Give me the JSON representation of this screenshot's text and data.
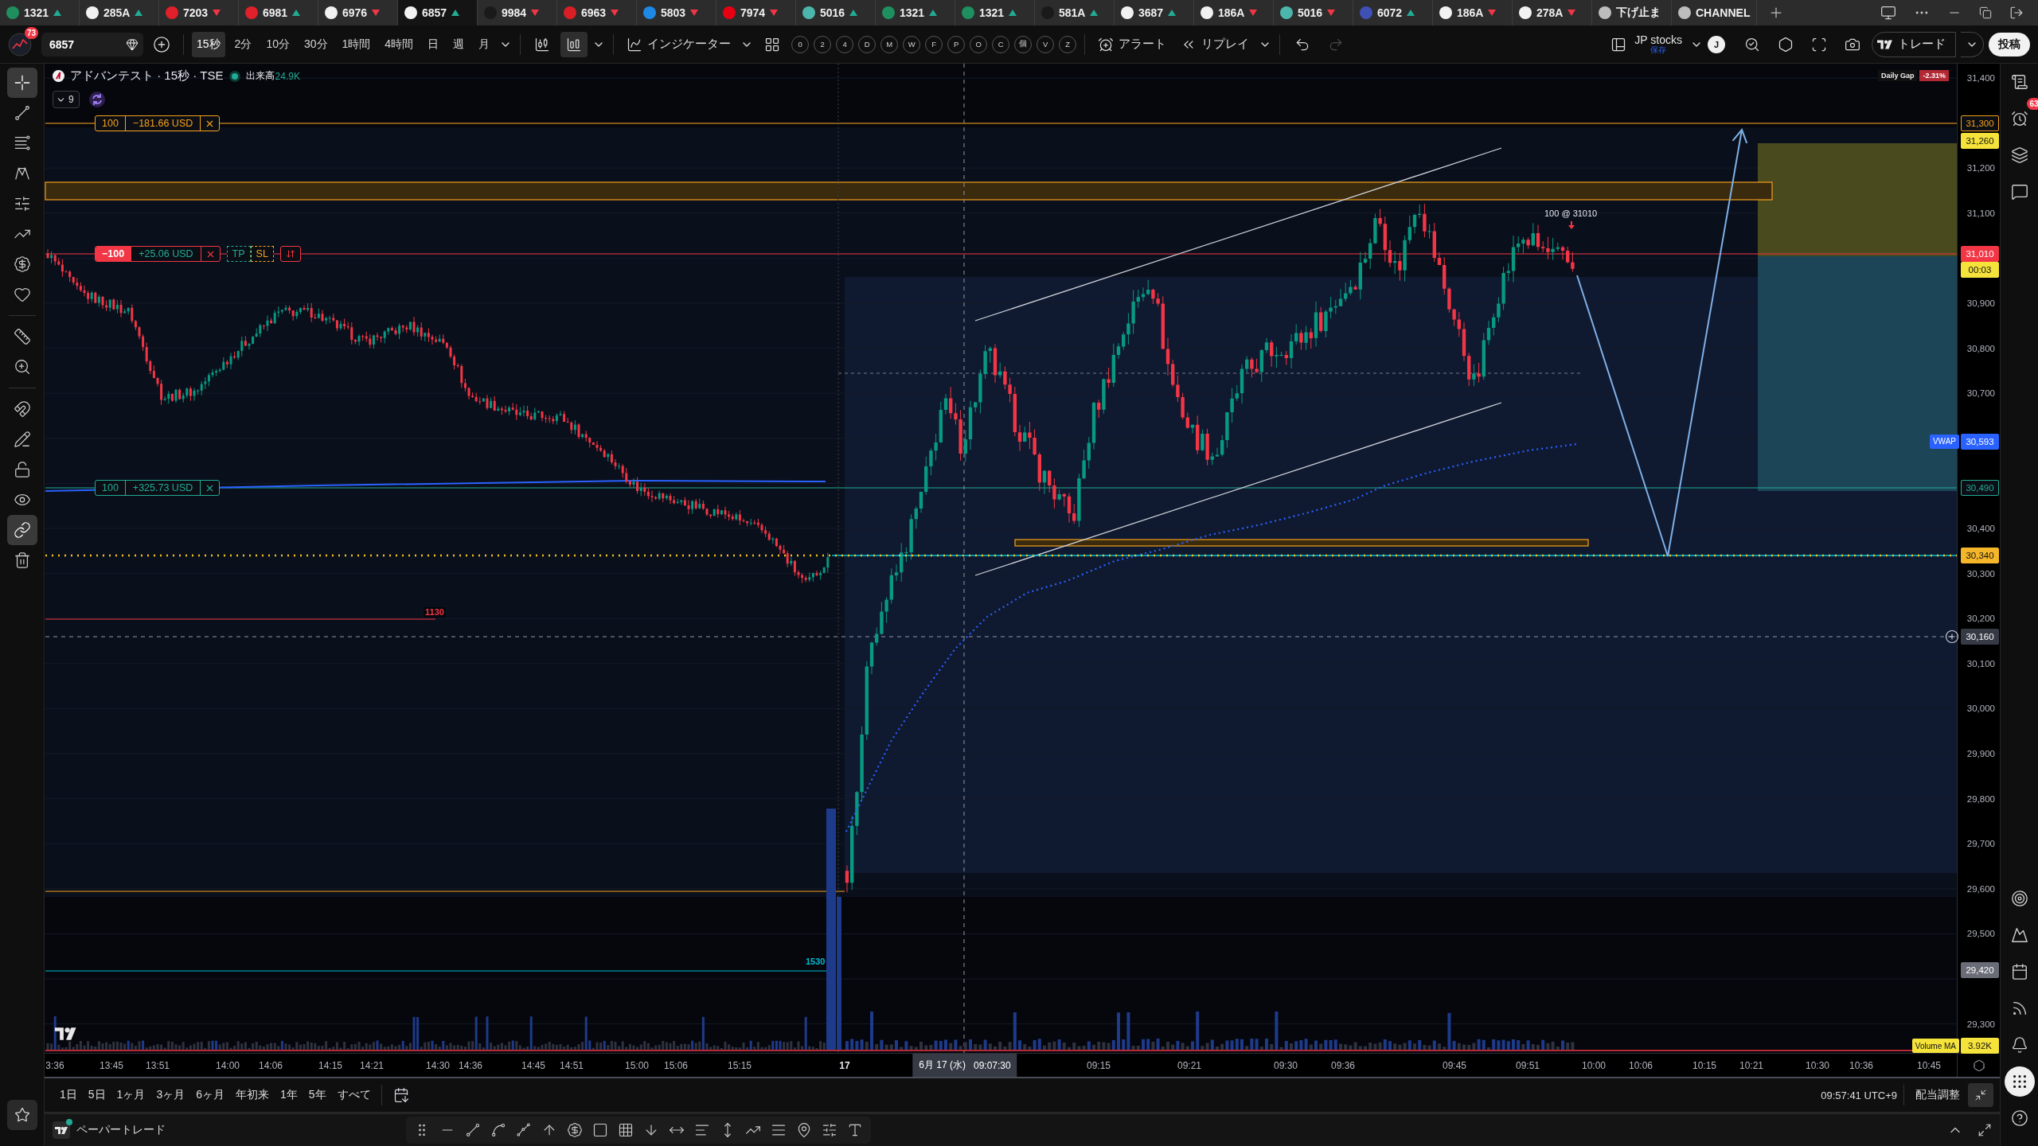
{
  "tabs": [
    {
      "symbol": "1321",
      "rising": true,
      "color": "#1f8f5f",
      "selected": false
    },
    {
      "symbol": "285A",
      "rising": true,
      "color": "#f2f2f2",
      "selected": false
    },
    {
      "symbol": "7203",
      "rising": false,
      "color": "#e0202a",
      "selected": false
    },
    {
      "symbol": "6981",
      "rising": true,
      "color": "#e0202a",
      "selected": false
    },
    {
      "symbol": "6976",
      "rising": false,
      "color": "#f2f2f2",
      "selected": false
    },
    {
      "symbol": "6857",
      "rising": true,
      "color": "#f2f2f2",
      "selected": true
    },
    {
      "symbol": "9984",
      "rising": false,
      "color": "#1a1a1a",
      "selected": false
    },
    {
      "symbol": "6963",
      "rising": false,
      "color": "#d81f26",
      "selected": false
    },
    {
      "symbol": "5803",
      "rising": false,
      "color": "#1e88e5",
      "selected": false
    },
    {
      "symbol": "7974",
      "rising": false,
      "color": "#e60012",
      "selected": false
    },
    {
      "symbol": "5016",
      "rising": true,
      "color": "#4db6ac",
      "selected": false
    },
    {
      "symbol": "1321",
      "rising": true,
      "color": "#1f8f5f",
      "selected": false
    },
    {
      "symbol": "1321",
      "rising": true,
      "color": "#1f8f5f",
      "selected": false
    },
    {
      "symbol": "581A",
      "rising": true,
      "color": "#1a1a1a",
      "selected": false
    },
    {
      "symbol": "3687",
      "rising": true,
      "color": "#f2f2f2",
      "selected": false
    },
    {
      "symbol": "186A",
      "rising": false,
      "color": "#f2f2f2",
      "selected": false
    },
    {
      "symbol": "5016",
      "rising": false,
      "color": "#4db6ac",
      "selected": false
    },
    {
      "symbol": "6072",
      "rising": true,
      "color": "#3f51b5",
      "selected": false
    },
    {
      "symbol": "186A",
      "rising": false,
      "color": "#f2f2f2",
      "selected": false
    },
    {
      "symbol": "278A",
      "rising": false,
      "color": "#f2f2f2",
      "selected": false
    },
    {
      "symbol": "下げ止ま",
      "color": "#bdbdbd",
      "selected": false
    },
    {
      "symbol": "CHANNEL",
      "color": "#bdbdbd",
      "selected": false
    }
  ],
  "toolbar": {
    "avatar_badge": "73",
    "symbol": "6857",
    "timeframes": [
      {
        "label": "15秒",
        "selected": true
      },
      {
        "label": "2分",
        "selected": false
      },
      {
        "label": "10分",
        "selected": false
      },
      {
        "label": "30分",
        "selected": false
      },
      {
        "label": "1時間",
        "selected": false
      },
      {
        "label": "4時間",
        "selected": false
      },
      {
        "label": "日",
        "selected": false
      },
      {
        "label": "週",
        "selected": false
      },
      {
        "label": "月",
        "selected": false
      }
    ],
    "chart_styles": [
      {
        "kind": "candles",
        "selected": false
      },
      {
        "kind": "hollow-candles",
        "selected": true
      }
    ],
    "indicators": "インジケーター",
    "hotkeys": [
      "0",
      "2",
      "4",
      "D",
      "M",
      "W",
      "F",
      "P",
      "O",
      "C",
      "個",
      "V",
      "Z"
    ],
    "alert": "アラート",
    "replay": "リプレイ",
    "history": [
      {
        "kind": "undo",
        "disabled": false
      },
      {
        "kind": "redo",
        "disabled": true
      }
    ],
    "layout": {
      "name": "JP stocks",
      "status": "保存"
    },
    "user_initial": "J",
    "trade": "トレード",
    "publish": "投稿"
  },
  "left_toolbar": [
    {
      "kind": "crosshair",
      "selected": true
    },
    {
      "kind": "trend-line",
      "selected": false
    },
    {
      "kind": "fib",
      "selected": false
    },
    {
      "kind": "pattern",
      "selected": false
    },
    {
      "kind": "position",
      "selected": false
    },
    {
      "kind": "prediction",
      "selected": false
    },
    {
      "kind": "price-note",
      "selected": false
    },
    {
      "kind": "favorites",
      "selected": false
    },
    {
      "kind": "ruler",
      "selected": false
    },
    {
      "kind": "zoom",
      "selected": false
    },
    {
      "kind": "magnet",
      "selected": false
    },
    {
      "kind": "drawing-lock",
      "selected": false
    },
    {
      "kind": "lock",
      "selected": false
    },
    {
      "kind": "visibility",
      "selected": false
    },
    {
      "kind": "sync",
      "selected": true
    },
    {
      "kind": "trash",
      "selected": false
    }
  ],
  "chart": {
    "legend": {
      "title": "アドバンテスト · 15秒 · TSE",
      "market_open": true,
      "volume_label": "出来高",
      "volume_value": "24.9K",
      "hidden_indicators": "9"
    },
    "daily_gap": {
      "label": "Daily Gap",
      "value": "-2.31%"
    },
    "order_lines": [
      {
        "kind": "stop",
        "quantity": "100",
        "pnl": "−181.66 USD"
      },
      {
        "kind": "position",
        "quantity": "−100",
        "pnl": "+25.06 USD",
        "brackets": [
          "TP",
          "SL"
        ]
      },
      {
        "kind": "limit",
        "quantity": "100",
        "pnl": "+325.73 USD"
      }
    ],
    "fill_label": "100 @ 31010",
    "line_labels": [
      {
        "text": "1130",
        "color": "#f23645"
      },
      {
        "text": "1530",
        "color": "#00bcd4"
      }
    ]
  },
  "price_scale": {
    "ticks": [
      "31,400",
      "31,200",
      "31,100",
      "30,900",
      "30,800",
      "30,700",
      "30,400",
      "30,300",
      "30,200",
      "30,100",
      "30,000",
      "29,900",
      "29,800",
      "29,700",
      "29,600",
      "29,500",
      "29,300"
    ],
    "badges": [
      {
        "kind": "order",
        "value": "31,300"
      },
      {
        "kind": "target",
        "value": "31,260"
      },
      {
        "kind": "last",
        "value": "31,010",
        "countdown": "00:03"
      },
      {
        "kind": "vwap",
        "label": "VWAP",
        "value": "30,593"
      },
      {
        "kind": "limit",
        "value": "30,490"
      },
      {
        "kind": "alert",
        "value": "30,340"
      },
      {
        "kind": "crosshair",
        "value": "30,160"
      },
      {
        "kind": "marker",
        "value": "29,420"
      }
    ]
  },
  "volume_ma": {
    "label": "Volume MA",
    "value": "3.92K"
  },
  "time_scale": {
    "ticks": [
      {
        "label": "3:36",
        "kind": "time"
      },
      {
        "label": "13:45",
        "kind": "time"
      },
      {
        "label": "13:51",
        "kind": "time"
      },
      {
        "label": "14:00",
        "kind": "time"
      },
      {
        "label": "14:06",
        "kind": "time"
      },
      {
        "label": "14:15",
        "kind": "time"
      },
      {
        "label": "14:21",
        "kind": "time"
      },
      {
        "label": "14:30",
        "kind": "time"
      },
      {
        "label": "14:36",
        "kind": "time"
      },
      {
        "label": "14:45",
        "kind": "time"
      },
      {
        "label": "14:51",
        "kind": "time"
      },
      {
        "label": "15:00",
        "kind": "time"
      },
      {
        "label": "15:06",
        "kind": "time"
      },
      {
        "label": "15:15",
        "kind": "time"
      },
      {
        "label": "17",
        "kind": "day"
      },
      {
        "label": "09:15",
        "kind": "time"
      },
      {
        "label": "09:21",
        "kind": "time"
      },
      {
        "label": "09:30",
        "kind": "time"
      },
      {
        "label": "09:36",
        "kind": "time"
      },
      {
        "label": "09:45",
        "kind": "time"
      },
      {
        "label": "09:51",
        "kind": "time"
      },
      {
        "label": "10:00",
        "kind": "time"
      },
      {
        "label": "10:06",
        "kind": "time"
      },
      {
        "label": "10:15",
        "kind": "time"
      },
      {
        "label": "10:21",
        "kind": "time"
      },
      {
        "label": "10:30",
        "kind": "time"
      },
      {
        "label": "10:36",
        "kind": "time"
      },
      {
        "label": "10:45",
        "kind": "time"
      }
    ],
    "crosshair": {
      "date": "6月 17 (水)",
      "time": "09:07:30"
    }
  },
  "range_bar": {
    "ranges": [
      "1日",
      "5日",
      "1ヶ月",
      "3ヶ月",
      "6ヶ月",
      "年初来",
      "1年",
      "5年",
      "すべて"
    ],
    "clock": "09:57:41 UTC+9",
    "adjustment": "配当調整"
  },
  "trading_panel": {
    "broker": "ペーパートレード",
    "connected": true
  },
  "right_sidebar": [
    {
      "kind": "watchlist",
      "selected": false
    },
    {
      "kind": "alerts",
      "selected": false,
      "badge": "63"
    },
    {
      "kind": "object-tree",
      "selected": false
    },
    {
      "kind": "chat",
      "selected": false
    },
    {
      "kind": "target",
      "selected": false
    },
    {
      "kind": "ideas",
      "selected": false
    },
    {
      "kind": "calendar",
      "selected": false
    },
    {
      "kind": "news",
      "selected": false
    },
    {
      "kind": "notifications",
      "selected": false
    },
    {
      "kind": "apps",
      "selected": true
    },
    {
      "kind": "help",
      "selected": false
    }
  ]
}
